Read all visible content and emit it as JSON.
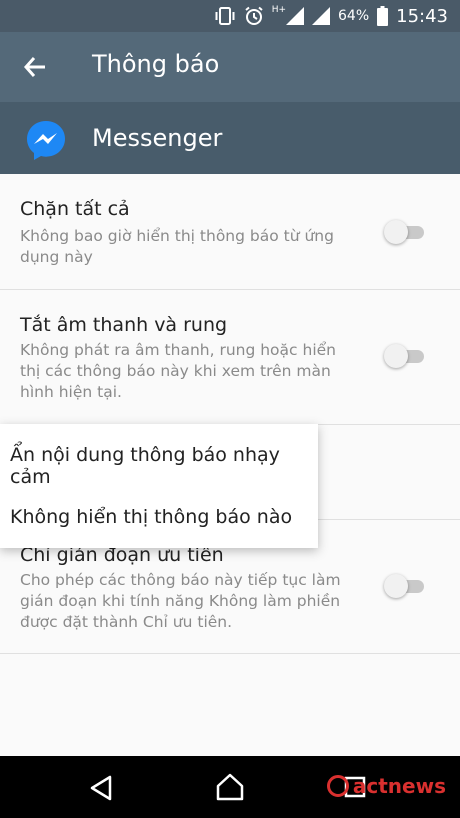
{
  "status_bar": {
    "signal_label": "H+",
    "battery_percent": "64%",
    "time": "15:43",
    "icons": [
      "vibrate-icon",
      "alarm-icon",
      "signal-icon",
      "signal-icon",
      "battery-icon"
    ]
  },
  "toolbar": {
    "title": "Thông báo",
    "back_icon": "back-arrow-icon"
  },
  "app": {
    "name": "Messenger",
    "icon": "messenger-icon",
    "brand_color": "#1e88f5"
  },
  "settings": [
    {
      "title": "Chặn tất cả",
      "description": "Không bao giờ hiển thị thông báo từ ứng dụng này",
      "enabled": false
    },
    {
      "title": "Tắt âm thanh và rung",
      "description": "Không phát ra âm thanh, rung hoặc hiển thị các thông báo này khi xem trên màn hình hiện tại.",
      "enabled": false
    },
    {
      "title": "Chỉ gián đoạn ưu tiên",
      "description": "Cho phép các thông báo này tiếp tục làm gián đoạn khi tính năng Không làm phiền được đặt thành Chỉ ưu tiên.",
      "enabled": false
    }
  ],
  "popup": {
    "options": [
      "Ẩn nội dung thông báo nhạy cảm",
      "Không hiển thị thông báo nào"
    ]
  },
  "nav_bar": {
    "icons": [
      "back-triangle-icon",
      "home-icon",
      "recents-icon"
    ]
  },
  "watermark": {
    "text": "actnews"
  },
  "colors": {
    "status_bar": "#4a5a68",
    "toolbar": "#546979",
    "app_header": "#485c6b",
    "background": "#fafafa",
    "watermark": "#d9302f"
  }
}
